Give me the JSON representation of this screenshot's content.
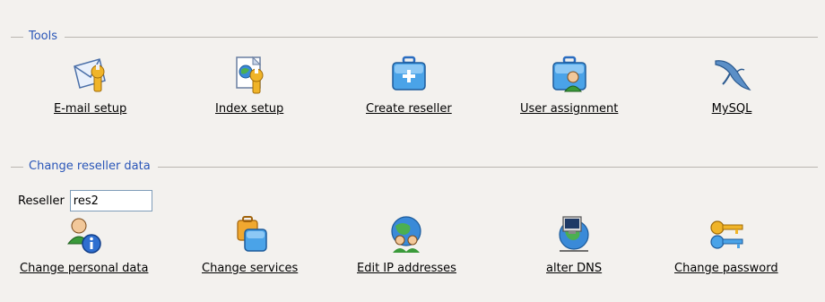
{
  "groups": {
    "tools": {
      "legend": "Tools"
    },
    "reseller": {
      "legend": "Change reseller data"
    }
  },
  "tools": [
    {
      "label": "E-mail setup",
      "icon": "email-setup-icon"
    },
    {
      "label": "Index setup",
      "icon": "index-setup-icon"
    },
    {
      "label": "Create reseller",
      "icon": "create-reseller-icon"
    },
    {
      "label": "User assignment",
      "icon": "user-assignment-icon"
    },
    {
      "label": "MySQL",
      "icon": "mysql-dolphin-icon"
    }
  ],
  "reseller_form": {
    "label": "Reseller",
    "value": "res2"
  },
  "reseller_actions": [
    {
      "label": "Change personal data",
      "icon": "personal-data-icon"
    },
    {
      "label": "Change services",
      "icon": "services-icon"
    },
    {
      "label": "Edit IP addresses",
      "icon": "ip-addresses-icon"
    },
    {
      "label": "alter DNS",
      "icon": "dns-icon"
    },
    {
      "label": "Change password",
      "icon": "password-keys-icon"
    }
  ],
  "colors": {
    "background": "#f3f1ee",
    "legend": "#2a56b8",
    "group_line": "#b9b6b0"
  }
}
